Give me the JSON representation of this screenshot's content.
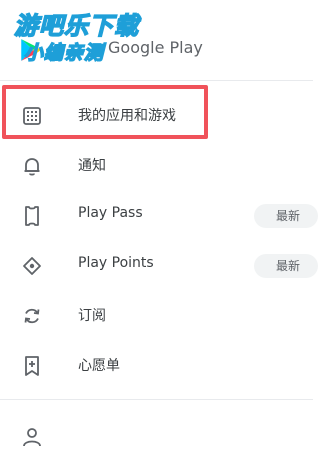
{
  "header": {
    "title": "Google Play",
    "watermark_line1": "游吧乐下载",
    "watermark_line2": "小编亲测"
  },
  "menu": {
    "items": [
      {
        "label": "我的应用和游戏",
        "icon": "apps-grid-icon",
        "highlighted": true
      },
      {
        "label": "通知",
        "icon": "bell-icon"
      },
      {
        "label": "Play Pass",
        "icon": "ticket-icon",
        "badge": "最新"
      },
      {
        "label": "Play Points",
        "icon": "diamond-icon",
        "badge": "最新"
      },
      {
        "label": "订阅",
        "icon": "refresh-icon"
      },
      {
        "label": "心愿单",
        "icon": "bookmark-add-icon"
      },
      {
        "label": "",
        "icon": "account-icon"
      }
    ]
  },
  "colors": {
    "highlight": "#f0525a",
    "watermark_stroke": "#1e9fd8",
    "icon": "#5f6368"
  }
}
